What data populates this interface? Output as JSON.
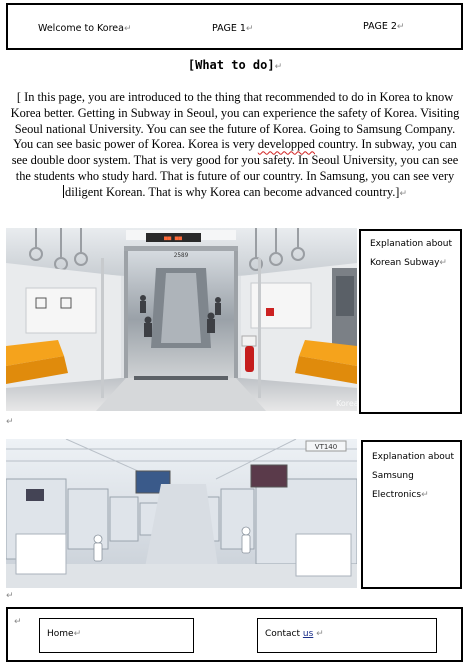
{
  "header": {
    "welcome": "Welcome to Korea",
    "page1": "PAGE 1",
    "page2": "PAGE 2"
  },
  "title": "[What to do]",
  "intro": {
    "part1": "[ In this page, you are introduced to the thing that recommended to do in Korea to know Korea better. Getting in Subway in Seoul, you can experience the safety of Korea. Visiting Seoul national University. You can see the future of Korea. Going to Samsung Company. You can see basic power of Korea. Korea is very ",
    "misspelled": "developped",
    "part2": " country. In subway, you can see double door system. That is very good for you safety. In Seoul University, you can see the students who study hard. That is future of our country. In Samsung, you can see very ",
    "part3": "diligent Korean. That is why Korea can become advanced country.]"
  },
  "subway": {
    "explanation_line1": "Explanation about",
    "explanation_line2": "Korean Subway",
    "sign_text": "2589",
    "watermark": "Korea"
  },
  "samsung": {
    "explanation_line1": "Explanation about",
    "explanation_line2": "Samsung",
    "explanation_line3": "Electronics",
    "sign_text": "VT140"
  },
  "footer": {
    "home": "Home",
    "contact": "Contact",
    "contact_us": "us"
  },
  "marks": {
    "para": "↵"
  },
  "colors": {
    "seat_orange": "#f5a31c",
    "spellcheck_red": "#d02020",
    "link_blue": "#1a2e8a"
  }
}
